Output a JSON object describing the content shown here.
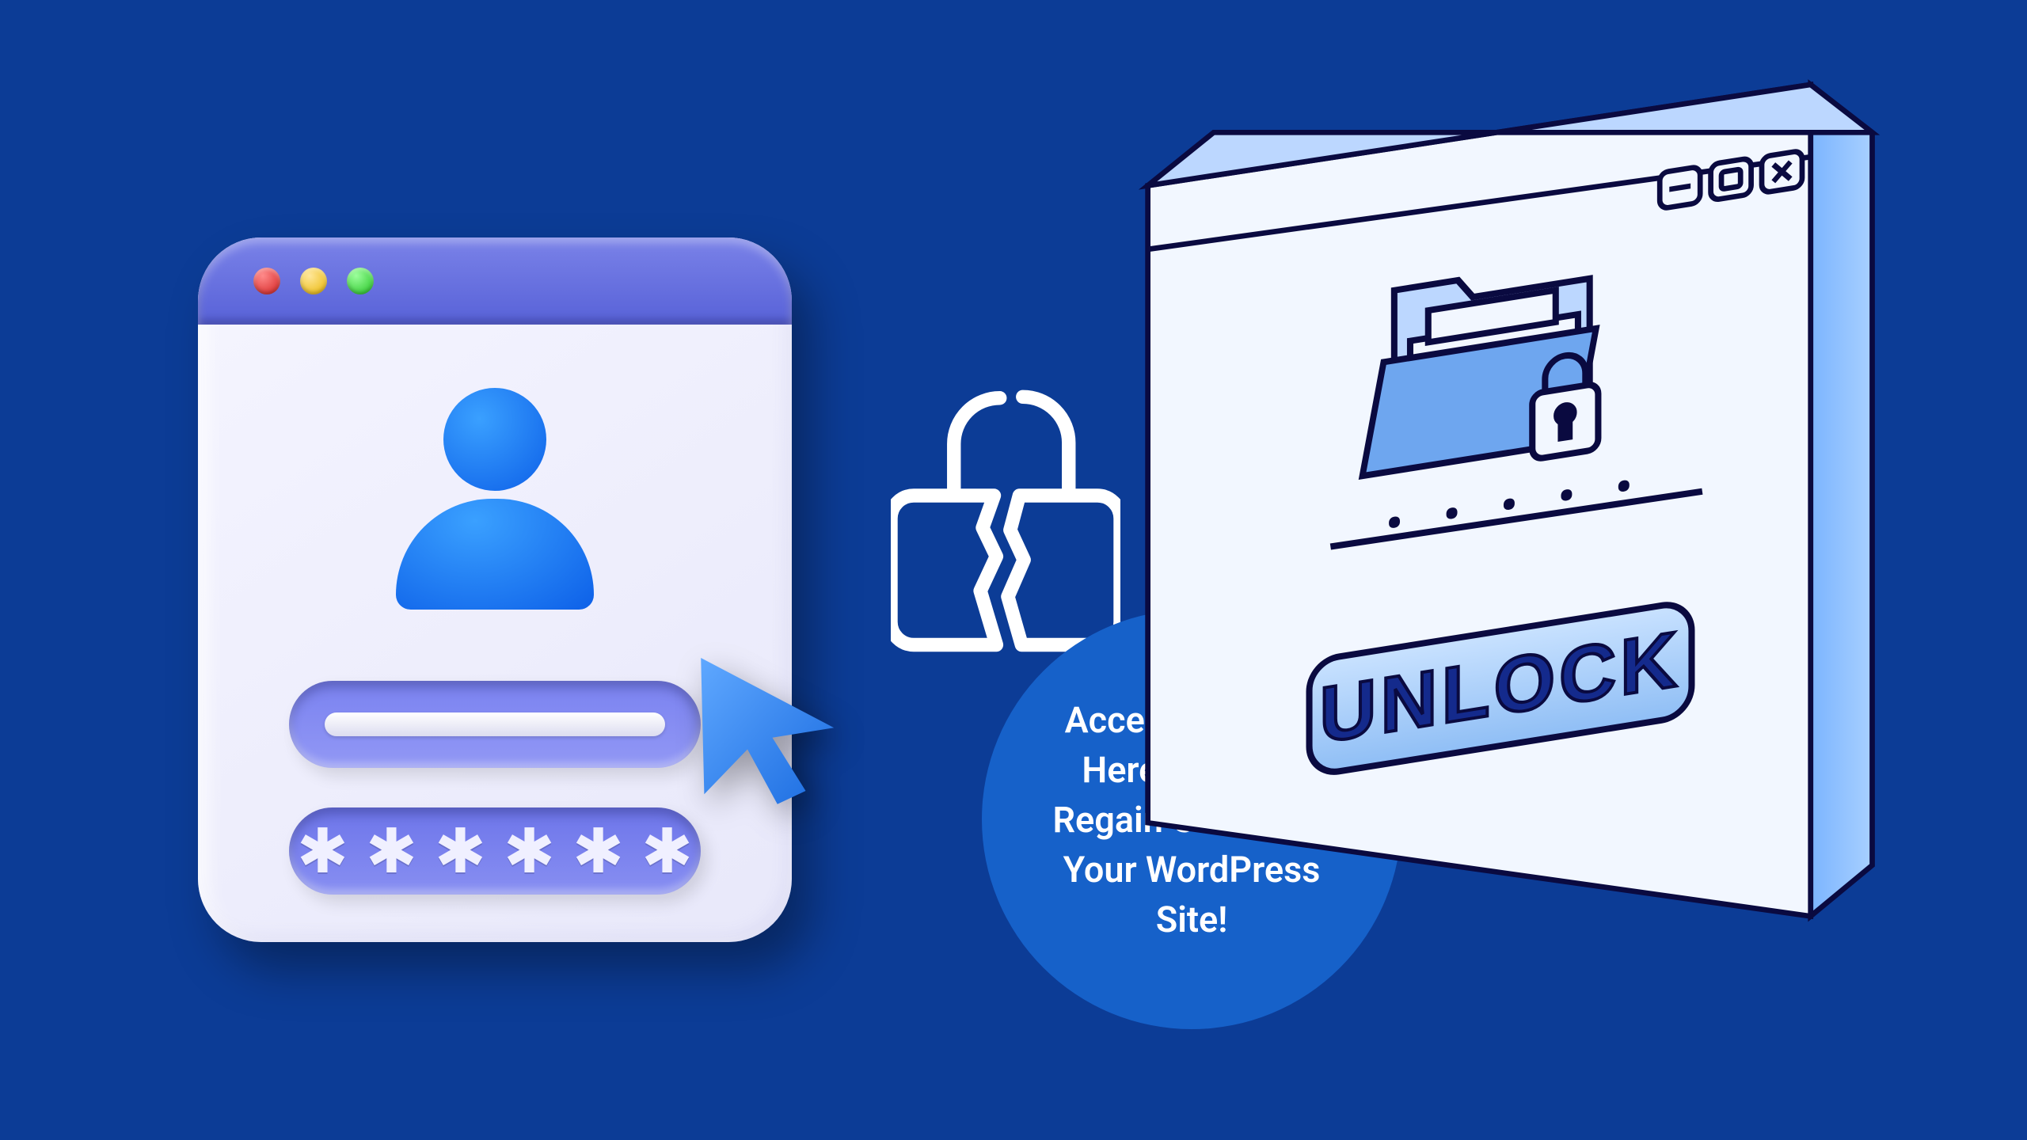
{
  "login_window": {
    "password_mask": "✱ ✱ ✱ ✱ ✱ ✱"
  },
  "callout": {
    "text": "Access Denied? Here's How to Regain Control of Your WordPress Site!"
  },
  "iso_window": {
    "button_label": "UNLOCK",
    "dots": "• • • • •"
  },
  "colors": {
    "background": "#0c3c96",
    "callout": "#1661c9",
    "accent_purple": "#7a82e8",
    "accent_blue": "#0d60e8"
  }
}
